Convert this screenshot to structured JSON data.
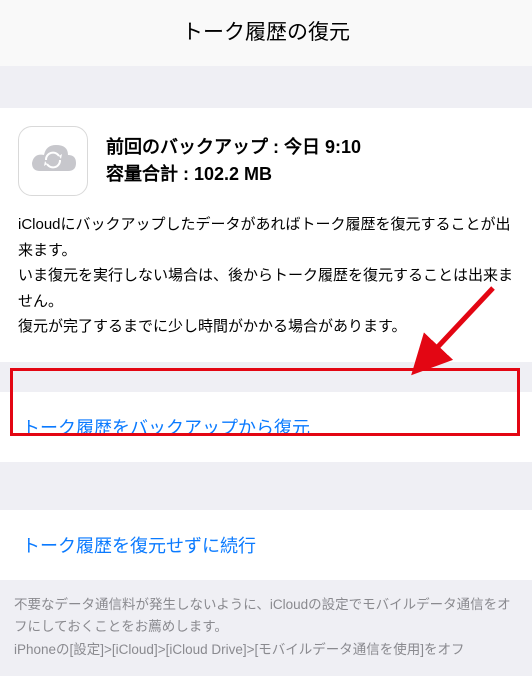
{
  "header": {
    "title": "トーク履歴の復元"
  },
  "backup": {
    "last_backup_label": "前回のバックアップ :",
    "last_backup_value": "今日 9:10",
    "size_label": "容量合計 :",
    "size_value": "102.2 MB",
    "description": "iCloudにバックアップしたデータがあればトーク履歴を復元することが出来ます。\nいま復元を実行しない場合は、後からトーク履歴を復元することは出来ません。\n復元が完了するまでに少し時間がかかる場合があります。"
  },
  "actions": {
    "restore_from_backup": "トーク履歴をバックアップから復元",
    "continue_without_restore": "トーク履歴を復元せずに続行"
  },
  "footnote": {
    "text": "不要なデータ通信料が発生しないように、iCloudの設定でモバイルデータ通信をオフにしておくことをお薦めします。\niPhoneの[設定]>[iCloud]>[iCloud Drive]>[モバイルデータ通信を使用]をオフ"
  },
  "icons": {
    "cloud_sync": "cloud-sync-icon"
  },
  "annotation": {
    "arrow": "arrow-red"
  }
}
